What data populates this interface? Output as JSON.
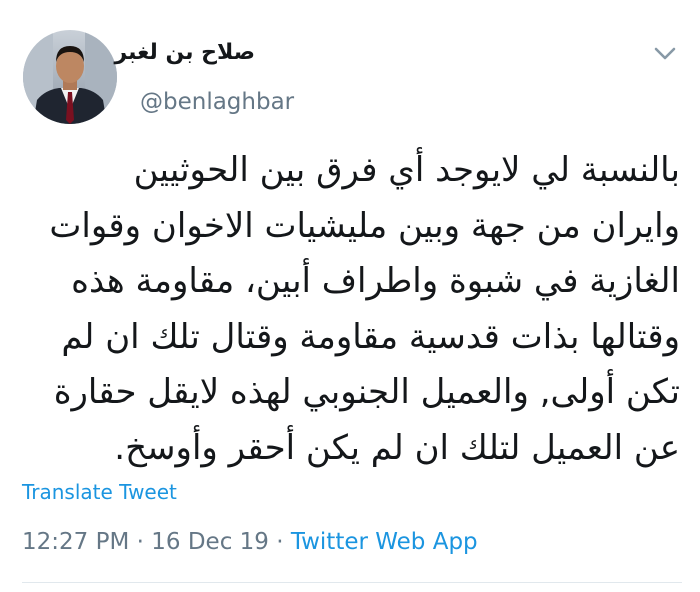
{
  "tweet": {
    "display_name": "صلاح بن لغبر",
    "handle": "@benlaghbar",
    "text": "بالنسبة لي لايوجد أي فرق بين الحوثيين\nوايران من جهة وبين مليشيات الاخوان وقوات\nالغازية في شبوة واطراف أبين، مقاومة هذه\nوقتالها بذات قدسية مقاومة وقتال تلك ان لم\nتكن أولى, والعميل الجنوبي لهذه لايقل حقارة\nعن العميل لتلك ان لم يكن أحقر وأوسخ.",
    "translate_label": "Translate Tweet",
    "time": "12:27 PM",
    "date": "16 Dec 19",
    "separator": " · ",
    "source": "Twitter Web App"
  },
  "icons": {
    "avatar": "profile-photo",
    "menu": "chevron-down-icon"
  },
  "colors": {
    "link": "#1b95e0",
    "secondary_text": "#657786",
    "primary_text": "#14171a",
    "divider": "#e1e8ed"
  }
}
